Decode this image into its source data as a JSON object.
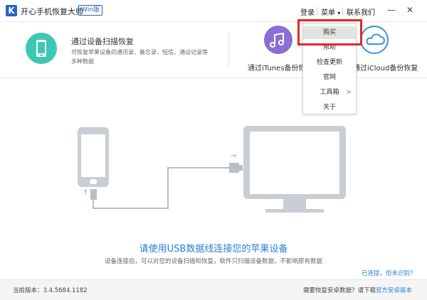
{
  "app": {
    "logo_letter": "K",
    "title": "开心手机恢复大师",
    "badge": "Win版"
  },
  "titlebar": {
    "login": "登录",
    "menu": "菜单",
    "menu_arrow": "▾",
    "contact": "联系我们",
    "minimize": "—",
    "close": "✕"
  },
  "modes": {
    "device": {
      "title": "通过设备扫描恢复",
      "desc_line1": "可恢复苹果设备的通讯录、备忘录、短信、通话记录等",
      "desc_line2": "多种数据",
      "color": "#3cc8b4",
      "icon": "phone-icon"
    },
    "itunes": {
      "title": "通过iTunes备份恢复",
      "color": "#8a6fd6",
      "icon": "music-note-icon",
      "glyph": "♫"
    },
    "icloud": {
      "title": "通过iCloud备份恢复",
      "color": "#3c8fe0",
      "icon": "cloud-icon"
    }
  },
  "main": {
    "usb_arrow_left": "↑",
    "usb_arrow_right": "→",
    "heading": "请使用USB数据线连接您的苹果设备",
    "subtext": "设备连接后，可以对您的设备扫描和恢复，软件只扫描设备数据，不影响原有数据",
    "connected_link": "已连接，但未识别？",
    "accent": "#2a7fd4"
  },
  "status": {
    "version_label": "当前版本：3.4.5684.1182",
    "android_prompt": "需要恢复安卓数据？请下载",
    "android_link": "官方安卓版本"
  },
  "menu": {
    "items": [
      {
        "label": "购买"
      },
      {
        "label": "帮助"
      },
      {
        "label": "检查更新"
      },
      {
        "label": "官网"
      },
      {
        "label": "工具箱",
        "submenu_arrow": ">"
      },
      {
        "label": "关于"
      }
    ],
    "highlight_color": "#e32727"
  }
}
